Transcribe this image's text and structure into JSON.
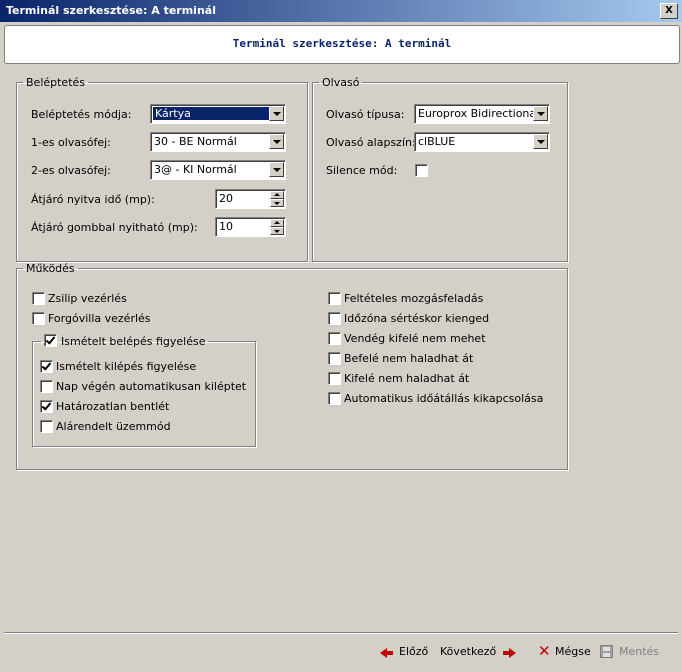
{
  "window": {
    "title": "Terminál szerkesztése: A terminál",
    "close_label": "X"
  },
  "header": {
    "title": "Terminál szerkesztése: A terminál"
  },
  "beleptetes": {
    "legend": "Beléptetés",
    "mode": {
      "label": "Beléptetés módja:",
      "value": "Kártya"
    },
    "reader1": {
      "label": "1-es olvasófej:",
      "value": "30 - BE Normál"
    },
    "reader2": {
      "label": "2-es olvasófej:",
      "value": "3@ - KI Normál"
    },
    "open_time": {
      "label": "Átjáró nyitva idő (mp):",
      "value": "20"
    },
    "button_open": {
      "label": "Átjáró gombbal nyitható (mp):",
      "value": "10"
    }
  },
  "olvaso": {
    "legend": "Olvasó",
    "type": {
      "label": "Olvasó típusa:",
      "value": "Europrox Bidirectional"
    },
    "color": {
      "label": "Olvasó alapszín:",
      "value": "clBLUE"
    },
    "silence": {
      "label": "Silence mód:",
      "checked": false
    }
  },
  "mukodes": {
    "legend": "Működés",
    "left": [
      {
        "label": "Zsilip vezérlés",
        "checked": false
      },
      {
        "label": "Forgóvilla vezérlés",
        "checked": false
      }
    ],
    "repeat_group": {
      "legend": "Ismételt belépés figyelése",
      "checked": true,
      "items": [
        {
          "label": "Ismételt kilépés figyelése",
          "checked": true
        },
        {
          "label": "Nap végén automatikusan kiléptet",
          "checked": false
        },
        {
          "label": "Határozatlan bentlét",
          "checked": true
        },
        {
          "label": "Alárendelt üzemmód",
          "checked": false
        }
      ]
    },
    "right": [
      {
        "label": "Feltételes mozgásfeladás",
        "checked": false
      },
      {
        "label": "Időzóna sértéskor kienged",
        "checked": false
      },
      {
        "label": "Vendég kifelé nem mehet",
        "checked": false
      },
      {
        "label": "Befelé nem haladhat át",
        "checked": false
      },
      {
        "label": "Kifelé nem haladhat át",
        "checked": false
      },
      {
        "label": "Automatikus időátállás kikapcsolása",
        "checked": false
      }
    ]
  },
  "footer": {
    "prev": "Előző",
    "next": "Következő",
    "cancel": "Mégse",
    "save": "Mentés"
  },
  "colors": {
    "title_start": "#0a246a",
    "title_end": "#a6caf0",
    "accent_red": "#c00000",
    "face": "#d4d0c8"
  }
}
